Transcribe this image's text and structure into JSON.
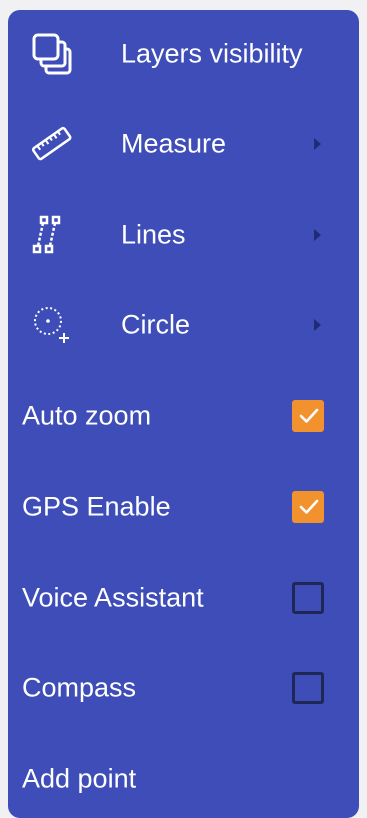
{
  "menu": {
    "items": [
      {
        "label": "Layers visibility",
        "icon": "layers-icon"
      },
      {
        "label": "Measure",
        "icon": "ruler-icon",
        "submenu": true
      },
      {
        "label": "Lines",
        "icon": "polyline-icon",
        "submenu": true
      },
      {
        "label": "Circle",
        "icon": "circle-add-icon",
        "submenu": true
      }
    ],
    "toggles": [
      {
        "label": "Auto zoom",
        "checked": true
      },
      {
        "label": "GPS Enable",
        "checked": true
      },
      {
        "label": "Voice Assistant",
        "checked": false
      },
      {
        "label": "Compass",
        "checked": false
      }
    ],
    "add_point_label": "Add point"
  },
  "colors": {
    "menu_bg": "#3e4db7",
    "checkbox_checked": "#f2922e",
    "checkbox_border": "#1f2757",
    "text": "#ffffff"
  }
}
